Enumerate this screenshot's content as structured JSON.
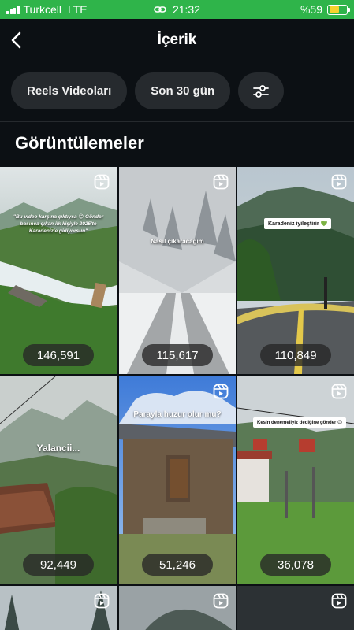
{
  "status_bar": {
    "carrier": "Turkcell",
    "network": "LTE",
    "time": "21:32",
    "battery_text": "%59",
    "battery_level": 0.59,
    "background_color": "#2fb44a",
    "icons": [
      "signal-icon",
      "link-icon",
      "battery-icon"
    ]
  },
  "header": {
    "title": "İçerik",
    "back_icon": "chevron-left-icon"
  },
  "filters": [
    {
      "label": "Reels Videoları"
    },
    {
      "label": "Son 30 gün"
    },
    {
      "icon": "sliders-icon"
    }
  ],
  "section": {
    "title": "Görüntülemeler"
  },
  "tiles": [
    {
      "views": "146,591",
      "caption": "\"Bu video karşına çıktıysa 😊 Gönder basınca çıkan ilk kişiyle 2025'te Karadeniz'e gidiyorsun\""
    },
    {
      "views": "115,617",
      "caption": "Nasıl çıkaracağım"
    },
    {
      "views": "110,849",
      "caption": "Karadeniz iyileştirir 💚"
    },
    {
      "views": "92,449",
      "caption": "Yalancii..."
    },
    {
      "views": "51,246",
      "caption": "Parayla huzur olur mu?"
    },
    {
      "views": "36,078",
      "caption": "Kesin denemeliyiz dediğine gönder 😊"
    },
    {
      "views": ""
    },
    {
      "views": ""
    },
    {
      "views": ""
    }
  ],
  "colors": {
    "background": "#0c1014",
    "chip": "#262a2e",
    "text": "#f5f5f5"
  }
}
